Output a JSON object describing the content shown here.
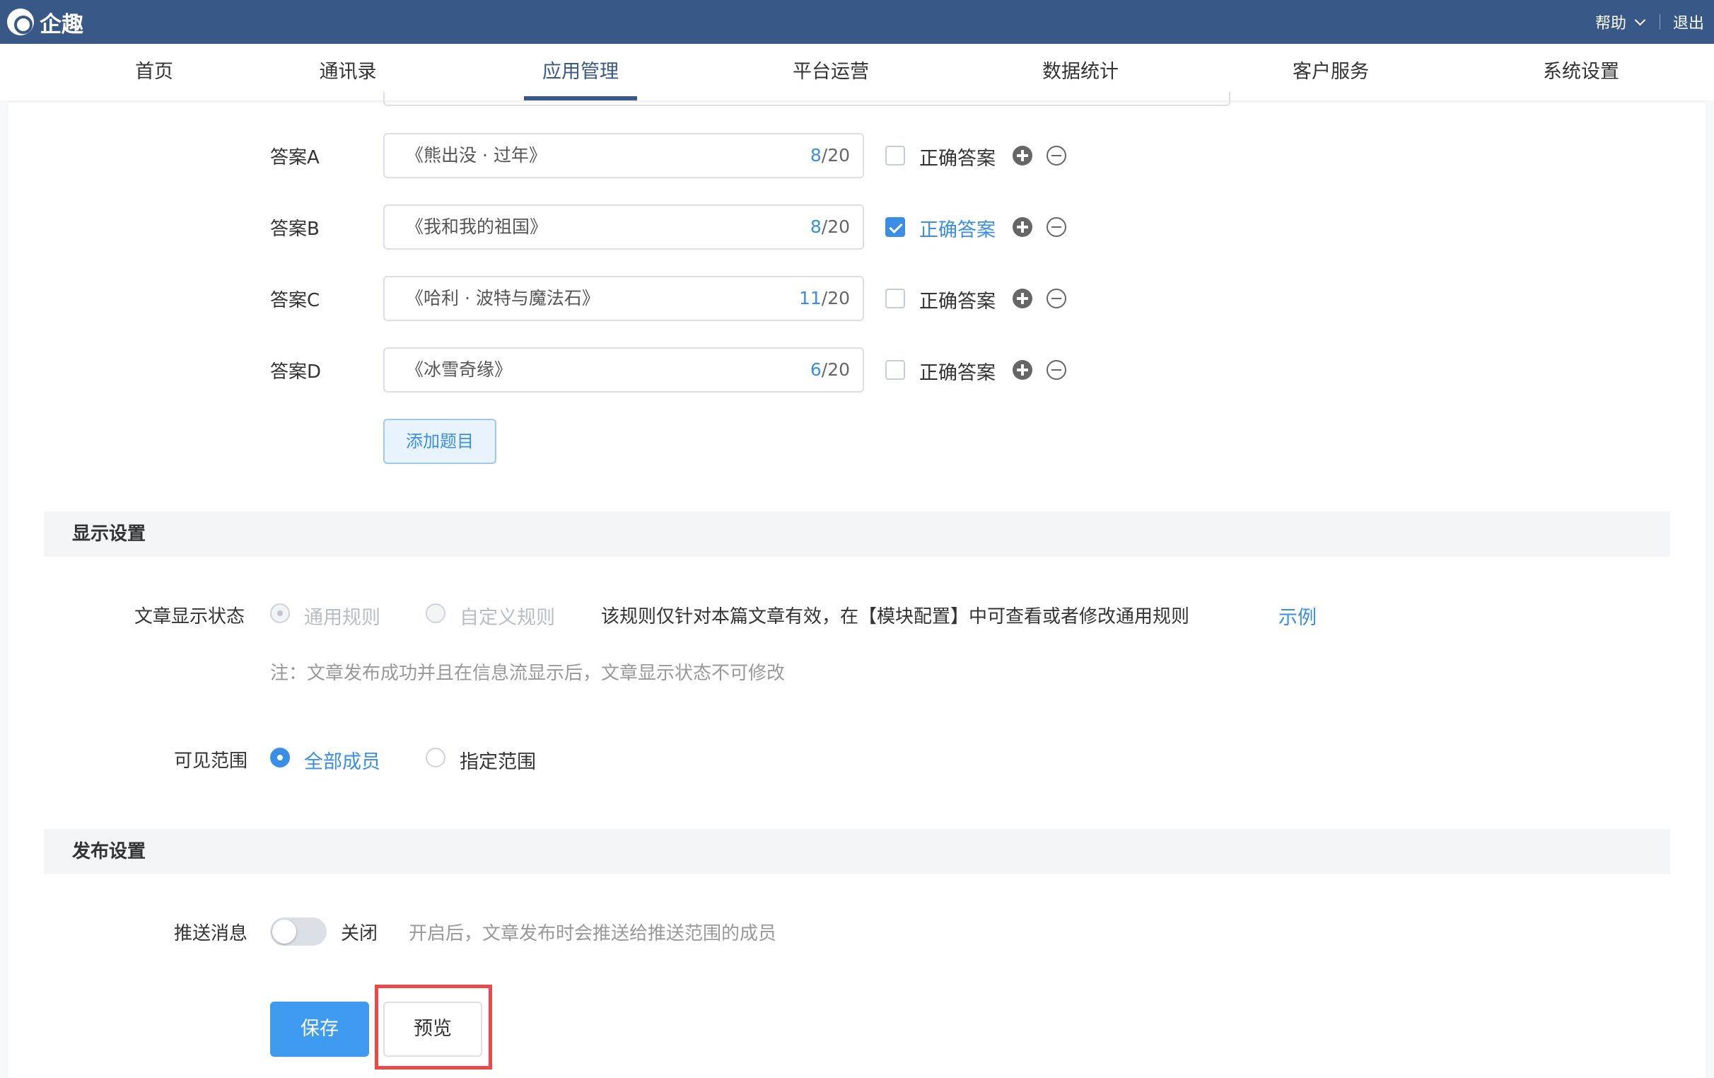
{
  "app": {
    "name": "企趣"
  },
  "header": {
    "help": "帮助",
    "logout": "退出"
  },
  "nav": {
    "items": [
      {
        "label": "首页"
      },
      {
        "label": "通讯录"
      },
      {
        "label": "应用管理"
      },
      {
        "label": "平台运营"
      },
      {
        "label": "数据统计"
      },
      {
        "label": "客户服务"
      },
      {
        "label": "系统设置"
      }
    ],
    "active": "应用管理"
  },
  "answers": [
    {
      "label": "答案A",
      "value": "《熊出没 · 过年》",
      "count": "8",
      "max": "/20",
      "correct": false,
      "correct_label": "正确答案"
    },
    {
      "label": "答案B",
      "value": "《我和我的祖国》",
      "count": "8",
      "max": "/20",
      "correct": true,
      "correct_label": "正确答案"
    },
    {
      "label": "答案C",
      "value": "《哈利 · 波特与魔法石》",
      "count": "11",
      "max": "/20",
      "correct": false,
      "correct_label": "正确答案"
    },
    {
      "label": "答案D",
      "value": "《冰雪奇缘》",
      "count": "6",
      "max": "/20",
      "correct": false,
      "correct_label": "正确答案"
    }
  ],
  "add_question": "添加题目",
  "display_settings": {
    "title": "显示设置",
    "article_status_label": "文章显示状态",
    "option_general": "通用规则",
    "option_custom": "自定义规则",
    "rule_hint": "该规则仅针对本篇文章有效，在【模块配置】中可查看或者修改通用规则",
    "example_link": "示例",
    "note": "注：文章发布成功并且在信息流显示后，文章显示状态不可修改",
    "visible_range_label": "可见范围",
    "option_all": "全部成员",
    "option_specified": "指定范围"
  },
  "publish_settings": {
    "title": "发布设置",
    "push_label": "推送消息",
    "push_state": "关闭",
    "push_hint": "开启后，文章发布时会推送给推送范围的成员"
  },
  "actions": {
    "save": "保存",
    "preview": "预览"
  },
  "colors": {
    "header_bg": "#385987",
    "accent": "#3a8ee6",
    "highlight_outline": "#e84a4a"
  }
}
